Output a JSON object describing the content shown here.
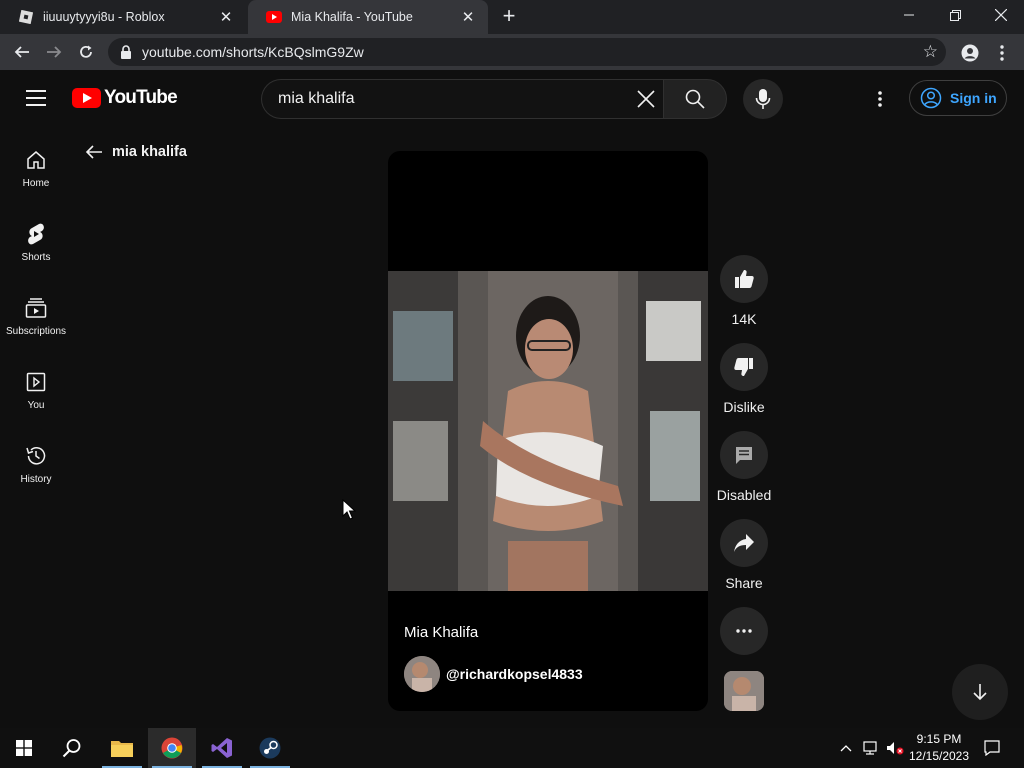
{
  "browser": {
    "tabs": [
      {
        "title": "iiuuuytyyyi8u - Roblox",
        "active": false
      },
      {
        "title": "Mia Khalifa - YouTube",
        "active": true
      }
    ],
    "url": "youtube.com/shorts/KcBQslmG9Zw"
  },
  "header": {
    "logo_text": "YouTube",
    "search_value": "mia khalifa",
    "signin_label": "Sign in"
  },
  "sidebar": {
    "items": [
      {
        "label": "Home",
        "icon": "home-icon"
      },
      {
        "label": "Shorts",
        "icon": "shorts-icon"
      },
      {
        "label": "Subscriptions",
        "icon": "subscriptions-icon"
      },
      {
        "label": "You",
        "icon": "you-icon"
      },
      {
        "label": "History",
        "icon": "history-icon"
      }
    ]
  },
  "back": {
    "query": "mia khalifa"
  },
  "short": {
    "title": "Mia Khalifa",
    "channel_handle": "@richardkopsel4833"
  },
  "actions": {
    "like_count": "14K",
    "dislike_label": "Dislike",
    "comments_label": "Disabled",
    "share_label": "Share"
  },
  "taskbar": {
    "time": "9:15 PM",
    "date": "12/15/2023"
  },
  "colors": {
    "background": "#0f0f0f",
    "brand_red": "#ff0000",
    "link_blue": "#3ea6ff",
    "chrome_dark": "#202124"
  }
}
